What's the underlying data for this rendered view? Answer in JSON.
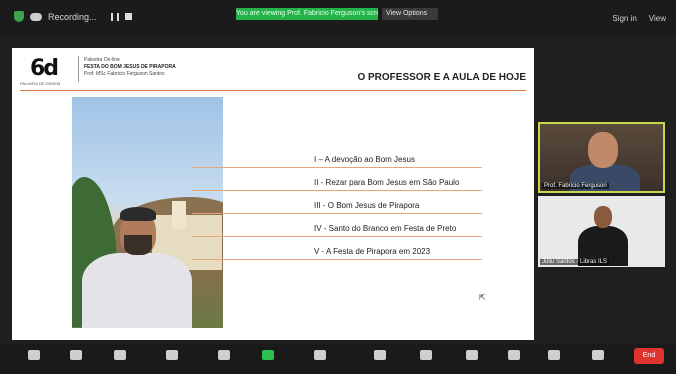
{
  "topbar": {
    "recording_label": "Recording...",
    "share_banner": "You are viewing Prof. Fabricio Ferguson's screen",
    "view_options": "View Options",
    "sign_in": "Sign in",
    "view": "View"
  },
  "slide": {
    "logo_sub": "PALAVRA DE ORDEM",
    "meta_line1": "Palestra On-line",
    "meta_line2": "FESTA DO BOM JESUS DE PIRAPORA",
    "meta_line3": "Prof. MSc Fabricio Ferguson Santos",
    "title": "O PROFESSOR E A AULA DE HOJE",
    "topics": [
      "I – A devoção ao Bom Jesus",
      "II - Rezar para Bom Jesus em São Paulo",
      "III - O Bom Jesus de Pirapora",
      "IV - Santo do Branco em Festa de Preto",
      "V - A Festa de Pirapora em 2023"
    ]
  },
  "participants": [
    {
      "name": "Prof. Fabricio Ferguson"
    },
    {
      "name": "Juliu Santos - Libras ILS"
    }
  ],
  "toolbar": {
    "end": "End"
  },
  "colors": {
    "accent_line": "#e07a3a",
    "share_green": "#24b34a",
    "speaker_border": "#c9d64b",
    "end_red": "#e0332f"
  }
}
